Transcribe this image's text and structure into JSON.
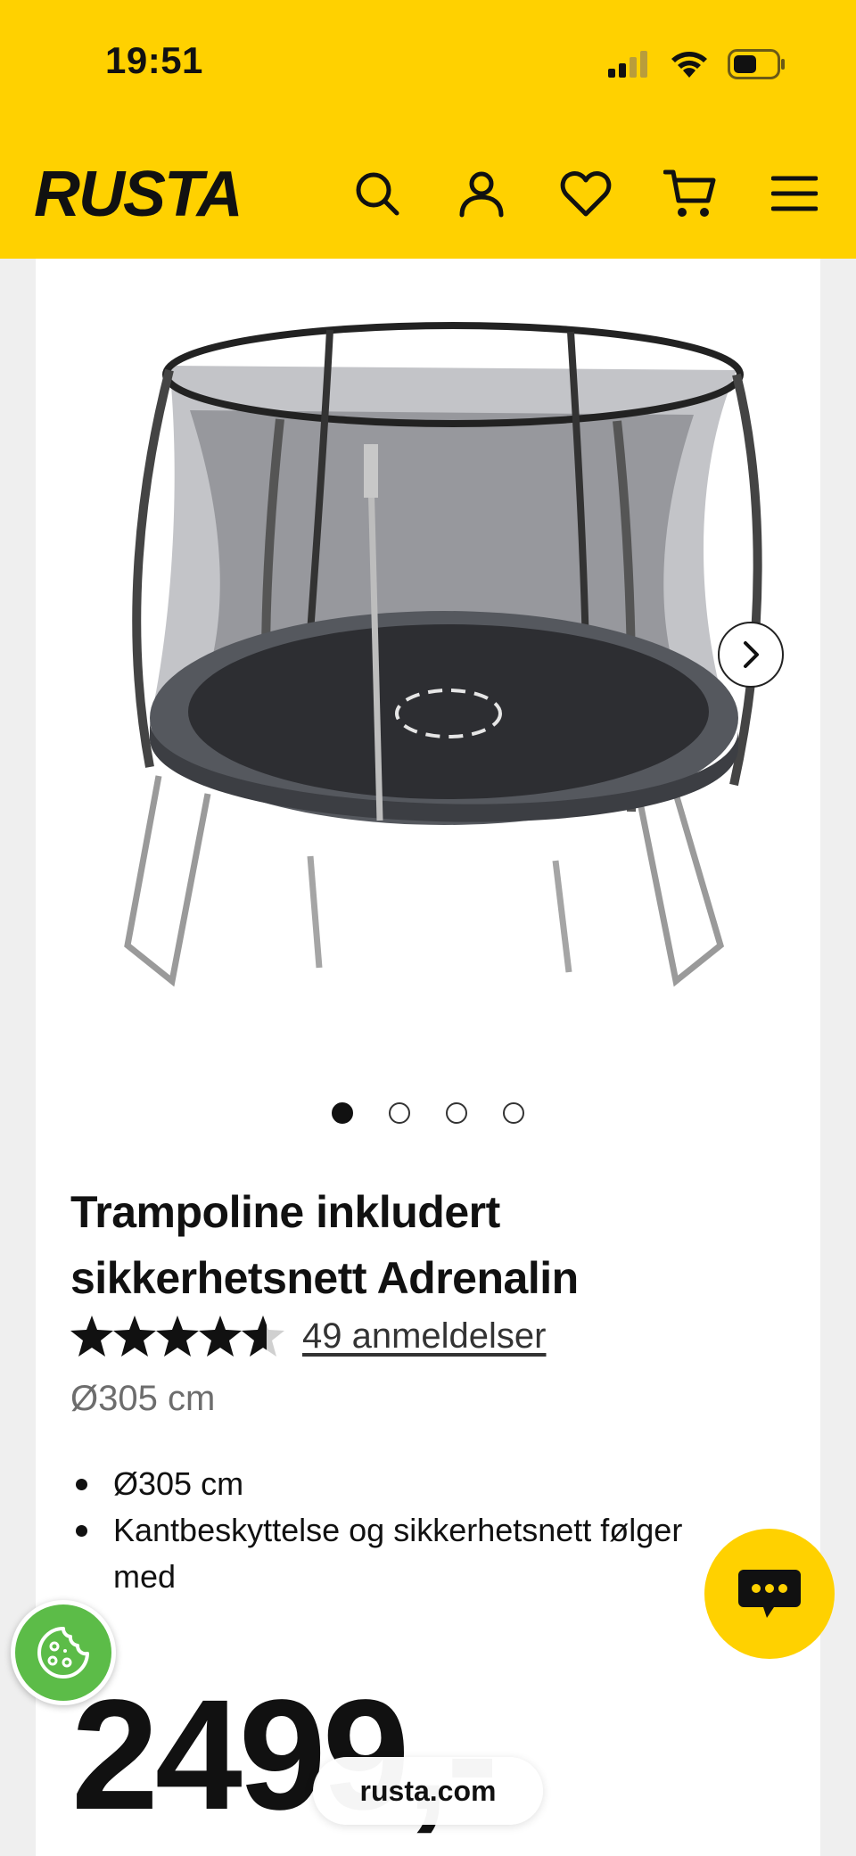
{
  "status_bar": {
    "time": "19:51",
    "icons": [
      "cellular-signal-icon",
      "wifi-icon",
      "battery-icon"
    ]
  },
  "header": {
    "logo_text": "RUSTA",
    "icons": [
      "search-icon",
      "account-icon",
      "heart-icon",
      "cart-icon",
      "menu-icon"
    ],
    "background_color": "#ffd100"
  },
  "gallery": {
    "image_alt": "trampoline-image",
    "total_images": 4,
    "active_index": 0,
    "next_icon": "chevron-right-icon"
  },
  "product": {
    "title": "Trampoline inkludert sikkerhetsnett Adrenalin",
    "rating_value": 4.5,
    "rating_max": 5,
    "reviews_label": "49 anmeldelser",
    "size_subtitle": "Ø305 cm",
    "features": [
      "Ø305 cm",
      "Kantbeskyttelse og sikkerhetsnett følger med"
    ],
    "price": "2499,-"
  },
  "floating": {
    "chat_icon": "chat-bubble-icon",
    "cookie_icon": "cookie-icon",
    "url": "rusta.com"
  }
}
